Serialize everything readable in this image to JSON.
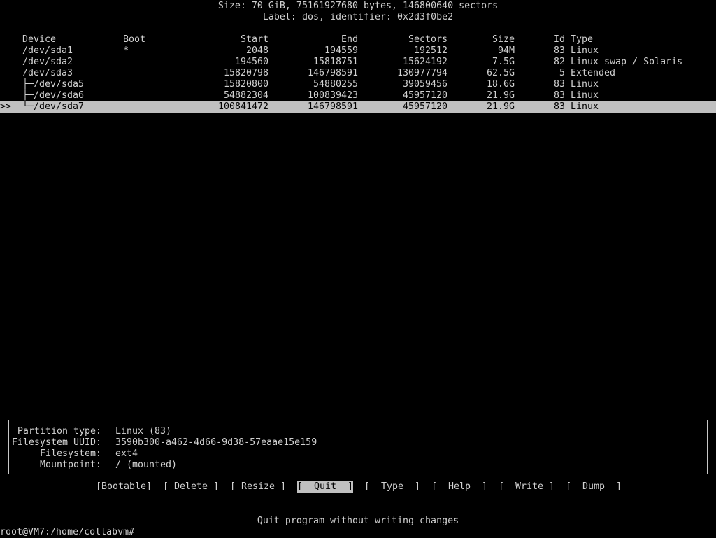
{
  "header": {
    "size_line": "Size: 70 GiB, 75161927680 bytes, 146800640 sectors",
    "label_line": "Label: dos, identifier: 0x2d3f0be2"
  },
  "table": {
    "columns": {
      "device": "Device",
      "boot": "Boot",
      "start": "Start",
      "end": "End",
      "sectors": "Sectors",
      "size": "Size",
      "id": "Id",
      "type": "Type"
    },
    "rows": [
      {
        "tree": "",
        "device": "/dev/sda1",
        "boot": "*",
        "start": "2048",
        "end": "194559",
        "sectors": "192512",
        "size": "94M",
        "id": "83",
        "type": "Linux",
        "selected": false
      },
      {
        "tree": "",
        "device": "/dev/sda2",
        "boot": "",
        "start": "194560",
        "end": "15818751",
        "sectors": "15624192",
        "size": "7.5G",
        "id": "82",
        "type": "Linux swap / Solaris",
        "selected": false
      },
      {
        "tree": "",
        "device": "/dev/sda3",
        "boot": "",
        "start": "15820798",
        "end": "146798591",
        "sectors": "130977794",
        "size": "62.5G",
        "id": "5",
        "type": "Extended",
        "selected": false
      },
      {
        "tree": "├─",
        "device": "/dev/sda5",
        "boot": "",
        "start": "15820800",
        "end": "54880255",
        "sectors": "39059456",
        "size": "18.6G",
        "id": "83",
        "type": "Linux",
        "selected": false
      },
      {
        "tree": "├─",
        "device": "/dev/sda6",
        "boot": "",
        "start": "54882304",
        "end": "100839423",
        "sectors": "45957120",
        "size": "21.9G",
        "id": "83",
        "type": "Linux",
        "selected": false
      },
      {
        "tree": "└─",
        "device": "/dev/sda7",
        "boot": "",
        "start": "100841472",
        "end": "146798591",
        "sectors": "45957120",
        "size": "21.9G",
        "id": "83",
        "type": "Linux",
        "selected": true
      }
    ],
    "selection_marker": ">>"
  },
  "info": {
    "partition_type_key": "Partition type:",
    "partition_type_val": "Linux (83)",
    "uuid_key": "Filesystem UUID:",
    "uuid_val": "3590b300-a462-4d66-9d38-57eaae15e159",
    "filesystem_key": "Filesystem:",
    "filesystem_val": "ext4",
    "mountpoint_key": "Mountpoint:",
    "mountpoint_val": "/ (mounted)"
  },
  "menu": {
    "bootable": "[Bootable]",
    "delete": "[ Delete ]",
    "resize": "[ Resize ]",
    "quit": "[  Quit  ]",
    "type": "[  Type  ]",
    "help": "[  Help  ]",
    "write": "[  Write ]",
    "dump": "[  Dump  ]"
  },
  "status": "Quit program without writing changes",
  "prompt": "root@VM7:/home/collabvm#"
}
